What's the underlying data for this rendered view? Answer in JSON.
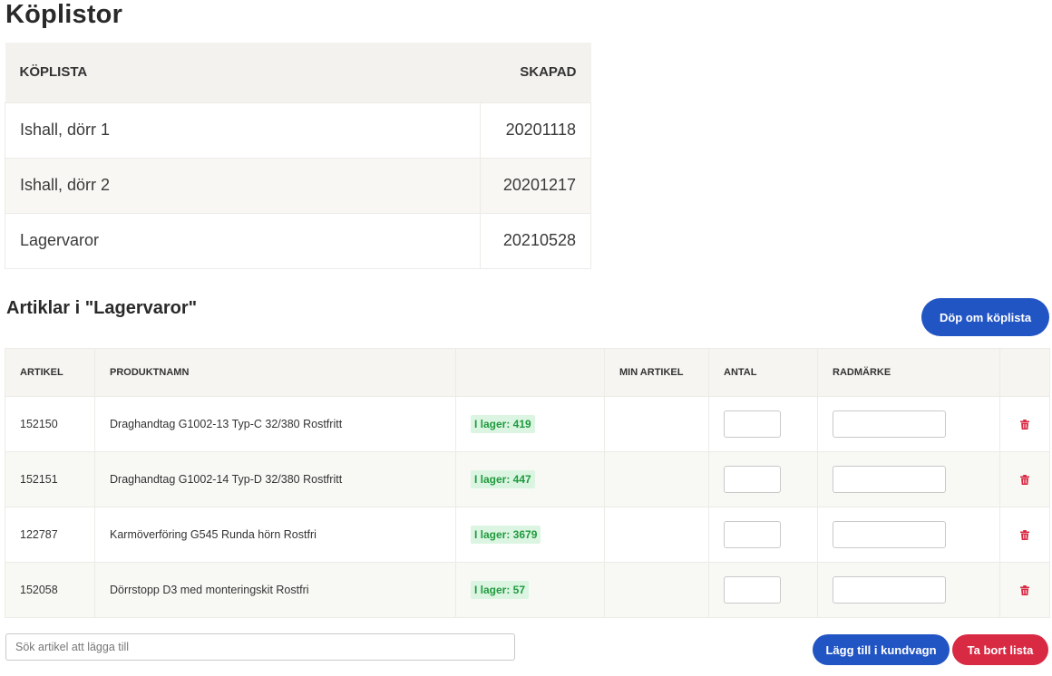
{
  "page": {
    "title": "Köplistor"
  },
  "lists": {
    "headers": {
      "name": "KÖPLISTA",
      "created": "SKAPAD"
    },
    "rows": [
      {
        "name": "Ishall, dörr 1",
        "created": "20201118"
      },
      {
        "name": "Ishall, dörr 2",
        "created": "20201217"
      },
      {
        "name": "Lagervaror",
        "created": "20210528"
      }
    ]
  },
  "articles": {
    "title": "Artiklar i \"Lagervaror\"",
    "rename_label": "Döp om köplista",
    "headers": {
      "article": "ARTIKEL",
      "product": "PRODUKTNAMN",
      "stock": "",
      "my_article": "MIN ARTIKEL",
      "qty": "ANTAL",
      "mark": "RADMÄRKE"
    },
    "rows": [
      {
        "article": "152150",
        "product": "Draghandtag G1002-13 Typ-C 32/380 Rostfritt",
        "stock": "I lager: 419",
        "my_article": ""
      },
      {
        "article": "152151",
        "product": "Draghandtag G1002-14 Typ-D 32/380 Rostfritt",
        "stock": "I lager: 447",
        "my_article": ""
      },
      {
        "article": "122787",
        "product": "Karmöverföring G545 Runda hörn Rostfri",
        "stock": "I lager: 3679",
        "my_article": ""
      },
      {
        "article": "152058",
        "product": "Dörrstopp D3 med monteringskit Rostfri",
        "stock": "I lager: 57",
        "my_article": ""
      }
    ]
  },
  "footer": {
    "search_placeholder": "Sök artikel att lägga till",
    "add_to_cart_label": "Lägg till i kundvagn",
    "delete_list_label": "Ta bort lista"
  },
  "icons": {
    "delete_row": "trash-icon"
  },
  "colors": {
    "primary": "#2255c4",
    "danger": "#d92a44",
    "stock_bg": "#dcf5e2",
    "stock_text": "#1f9a3e",
    "trash": "#d92a44"
  }
}
